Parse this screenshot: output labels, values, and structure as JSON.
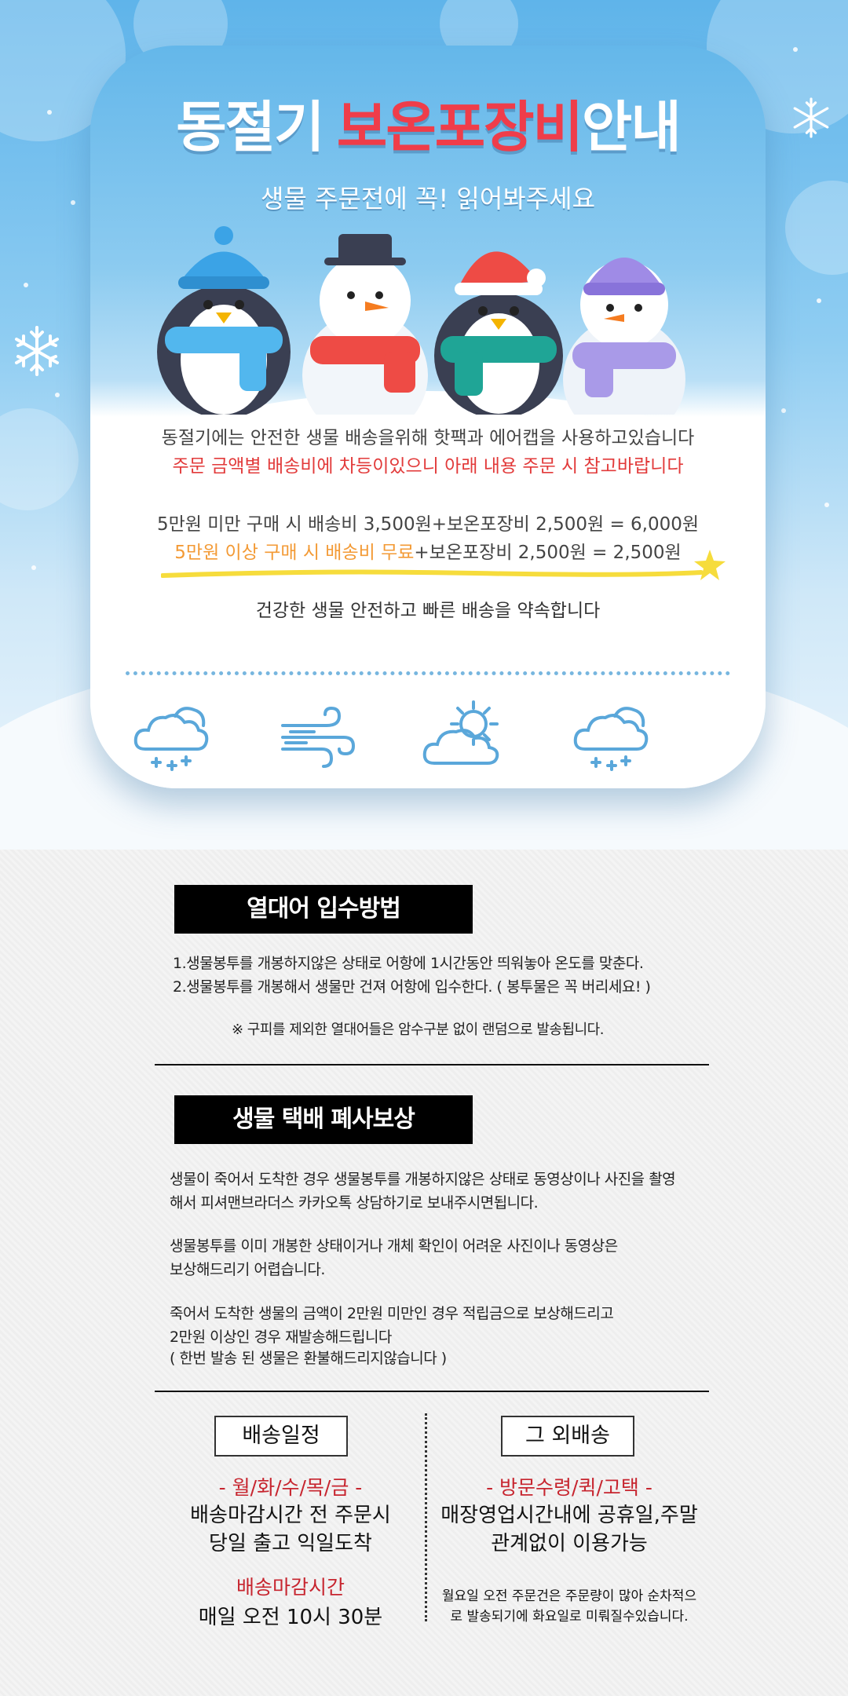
{
  "banner": {
    "title_part1": "동절기 ",
    "title_part2": "보온포장비",
    "title_part3": "안내",
    "subtitle": "생물 주문전에 꼭! 읽어봐주세요",
    "notice_line1": "동절기에는 안전한 생물 배송을위해 핫팩과 에어캡을 사용하고있습니다",
    "notice_line2": "주문 금액별 배송비에 차등이있으니 아래 내용 주문 시 참고바랍니다",
    "price_line1": "5만원 미만 구매 시 배송비 3,500원+보온포장비 2,500원 = 6,000원",
    "price_line2_highlight": "5만원 이상 구매 시 배송비 무료",
    "price_line2_rest": "+보온포장비 2,500원 = 2,500원",
    "promise": "건강한 생물 안전하고 빠른 배송을 약속합니다",
    "colors": {
      "accent_red": "#ef3d4a",
      "accent_orange": "#f39a35",
      "sky_blue": "#64b7ea"
    },
    "weather_icons": [
      "snow-cloud-icon",
      "wind-icon",
      "sun-cloud-icon",
      "snow-cloud-icon"
    ]
  },
  "section1": {
    "title": "열대어 입수방법",
    "line1": "1.생물봉투를 개봉하지않은 상태로 어항에 1시간동안 띄워놓아 온도를 맞춘다.",
    "line2": "2.생물봉투를 개봉해서 생물만 건져 어항에 입수한다. ( 봉투물은 꼭 버리세요! )",
    "note": "※ 구피를 제외한 열대어들은 암수구분 없이 랜덤으로 발송됩니다."
  },
  "section2": {
    "title": "생물 택배 폐사보상",
    "p1_line1": "생물이 죽어서 도착한 경우 생물봉투를 개봉하지않은 상태로 동영상이나 사진을 촬영",
    "p1_line2": "해서 피셔맨브라더스 카카오톡 상담하기로 보내주시면됩니다.",
    "p2_line1": "생물봉투를 이미 개봉한 상태이거나 개체 확인이 어려운 사진이나 동영상은",
    "p2_line2": "보상해드리기 어렵습니다.",
    "p3_line1": "죽어서 도착한 생물의 금액이 2만원 미만인 경우 적립금으로 보상해드리고",
    "p3_line2": "2만원 이상인 경우 재발송해드립니다",
    "p3_line3": "( 한번 발송 된 생물은 환불해드리지않습니다 )"
  },
  "shipping": {
    "left_label": "배송일정",
    "left_days": "- 월/화/수/목/금 -",
    "left_line1": "배송마감시간 전 주문시",
    "left_line2": "당일 출고 익일도착",
    "left_cutoff_label": "배송마감시간",
    "left_cutoff_value": "매일 오전 10시 30분",
    "right_label": "그 외배송",
    "right_types": "- 방문수령/퀵/고택 -",
    "right_line1": "매장영업시간내에 공휴일,주말",
    "right_line2": "관계없이 이용가능",
    "right_note1": "월요일 오전 주문건은 주문량이 많아 순차적으",
    "right_note2": "로 발송되기에 화요일로 미뤄질수있습니다."
  }
}
